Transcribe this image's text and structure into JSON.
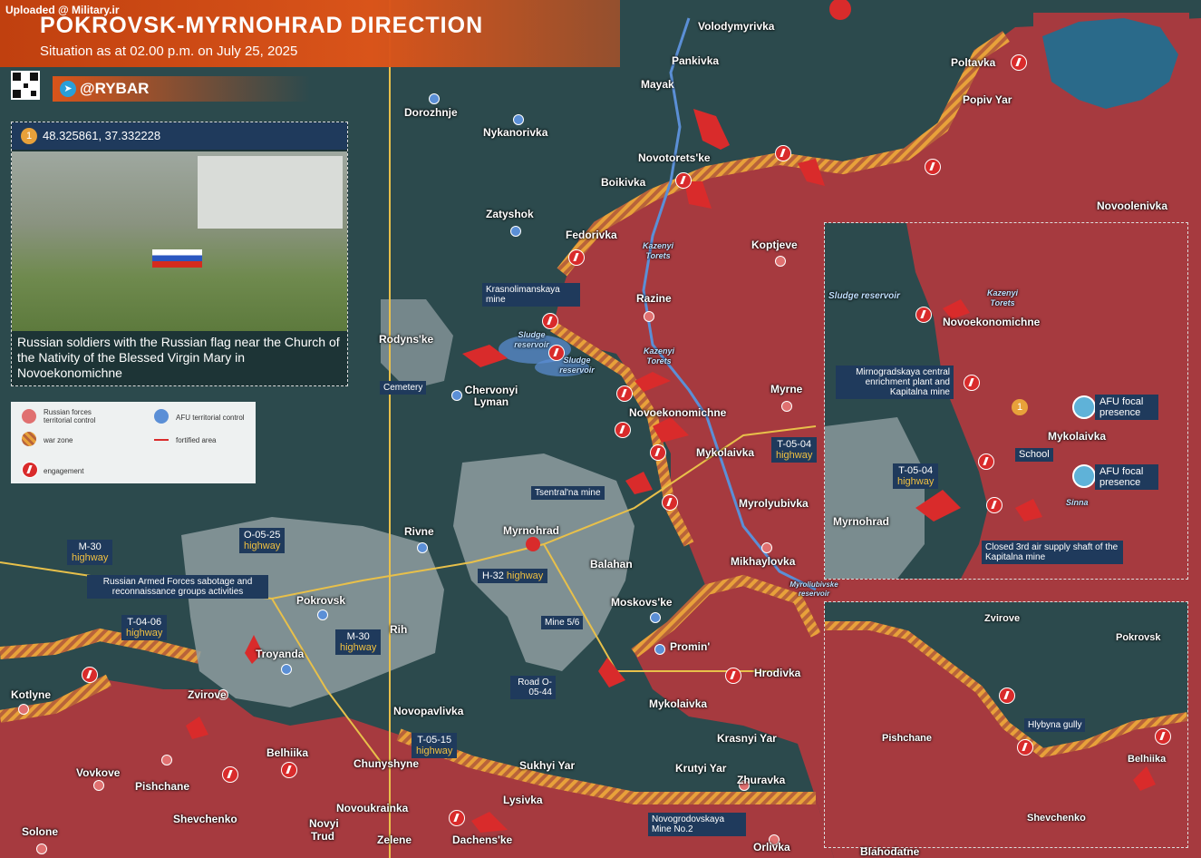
{
  "header": {
    "uploaded": "Uploaded @ Military.ir",
    "title": "POKROVSK-MYRNOHRAD DIRECTION",
    "subtitle": "Situation as at 02.00 p.m. on July 25, 2025",
    "brand": "@RYBAR"
  },
  "photo": {
    "badge": "1",
    "coordinates": "48.325861, 37.332228",
    "caption": "Russian soldiers with the Russian flag near the Church of the Nativity of the Blessed Virgin Mary in Novoekonomichne"
  },
  "legend": {
    "ru_control": "Russian forces territorial control",
    "afu_control": "AFU territorial control",
    "war_zone": "war zone",
    "fortified": "fortified area",
    "engagement": "engagement"
  },
  "colors": {
    "ru_territory": "#a63a3f",
    "afu_territory": "#2c4a4d",
    "war_zone": "#e8a13a",
    "engagement": "#d92b2b",
    "afu_marker": "#5b8fd6",
    "label_box": "#1f3a5c"
  },
  "places": {
    "volodymyrivka": "Volodymyrivka",
    "pankivka": "Pankivka",
    "mayak": "Mayak",
    "poltavka": "Poltavka",
    "popiv_yar": "Popiv Yar",
    "dorozhnje": "Dorozhnje",
    "nykanorivka": "Nykanorivka",
    "novotoretske": "Novotorets'ke",
    "boikivka": "Boikivka",
    "novoolenivka": "Novoolenivka",
    "zatyshok": "Zatyshok",
    "fedorivka": "Fedorivka",
    "koptjeve": "Koptjeve",
    "razine": "Razine",
    "rodynske": "Rodyns'ke",
    "chervonyi_lyman": "Chervonyi Lyman",
    "myrne": "Myrne",
    "novoekonomichne": "Novoekonomichne",
    "mykolaivka": "Mykolaivka",
    "myrolyubivka": "Myrolyubivka",
    "rivne": "Rivne",
    "myrnohrad": "Myrnohrad",
    "balahan": "Balahan",
    "mikhaylovka": "Mikhaylovka",
    "pokrovsk": "Pokrovsk",
    "moskovske": "Moskovs'ke",
    "rih": "Rih",
    "troyanda": "Troyanda",
    "promin": "Promin'",
    "kotlyne": "Kotlyne",
    "zvirove": "Zvirove",
    "hrodivka": "Hrodivka",
    "novopavlivka": "Novopavlivka",
    "mykolaivka_south": "Mykolaivka",
    "belhiika": "Belhiika",
    "krasnyi_yar": "Krasnyi Yar",
    "vovkove": "Vovkove",
    "chunyshyne": "Chunyshyne",
    "krutyi_yar": "Krutyi Yar",
    "sukhyi_yar": "Sukhyi Yar",
    "pishchane": "Pishchane",
    "zhuravka": "Zhuravka",
    "lysivka": "Lysivka",
    "novoukrainka": "Novoukrainka",
    "shevchenko": "Shevchenko",
    "solone": "Solone",
    "novyi_trud": "Novyi Trud",
    "zelene": "Zelene",
    "dachenske": "Dachens'ke",
    "orlivka": "Orlivka",
    "blahodatne": "Blahodatne"
  },
  "water": {
    "kazenyi_torets_1": "Kazenyi Torets",
    "kazenyi_torets_2": "Kazenyi Torets",
    "sludge_reservoir_1": "Sludge reservoir",
    "sludge_reservoir_2": "Sludge reservoir",
    "myroliubivske": "Myroliubivske reservoir"
  },
  "callouts": {
    "krasnolimanskaya": "Krasnolimanskaya mine",
    "cemetery": "Cemetery",
    "tsentralna": "Tsentral'na mine",
    "mine56": "Mine 5/6",
    "road_o0544": "Road O-05-44",
    "novogrodovskaya": "Novogrodovskaya Mine No.2",
    "sabotage": "Russian Armed Forces sabotage and reconnaissance groups activities"
  },
  "roads": {
    "m30_a": {
      "name": "M-30",
      "suffix": "highway"
    },
    "o0525": {
      "name": "O-05-25",
      "suffix": "highway"
    },
    "t0406": {
      "name": "T-04-06",
      "suffix": "highway"
    },
    "m30_b": {
      "name": "M-30",
      "suffix": "highway"
    },
    "h32": {
      "name": "H-32",
      "suffix": "highway"
    },
    "t0504": {
      "name": "T-05-04",
      "suffix": "highway"
    },
    "t0515": {
      "name": "T-05-15",
      "suffix": "highway"
    }
  },
  "inset1": {
    "sludge": "Sludge reservoir",
    "kazenyi": "Kazenyi Torets",
    "novoekonomichne": "Novoekonomichne",
    "plant": "Mirnogradskaya central enrichment plant and Kapitalna mine",
    "badge": "1",
    "afu1": "AFU focal presence",
    "afu2": "AFU focal presence",
    "mykolaivka": "Mykolaivka",
    "school": "School",
    "road": "T-05-04",
    "road_suffix": "highway",
    "myrnohrad": "Myrnohrad",
    "shaft": "Closed 3rd air supply shaft of the Kapitalna mine",
    "river": "Sinna"
  },
  "inset2": {
    "zvirove": "Zvirove",
    "pokrovsk": "Pokrovsk",
    "pishchane": "Pishchane",
    "hlybyna": "Hlybyna gully",
    "belhiika": "Belhiika",
    "shevchenko": "Shevchenko"
  }
}
